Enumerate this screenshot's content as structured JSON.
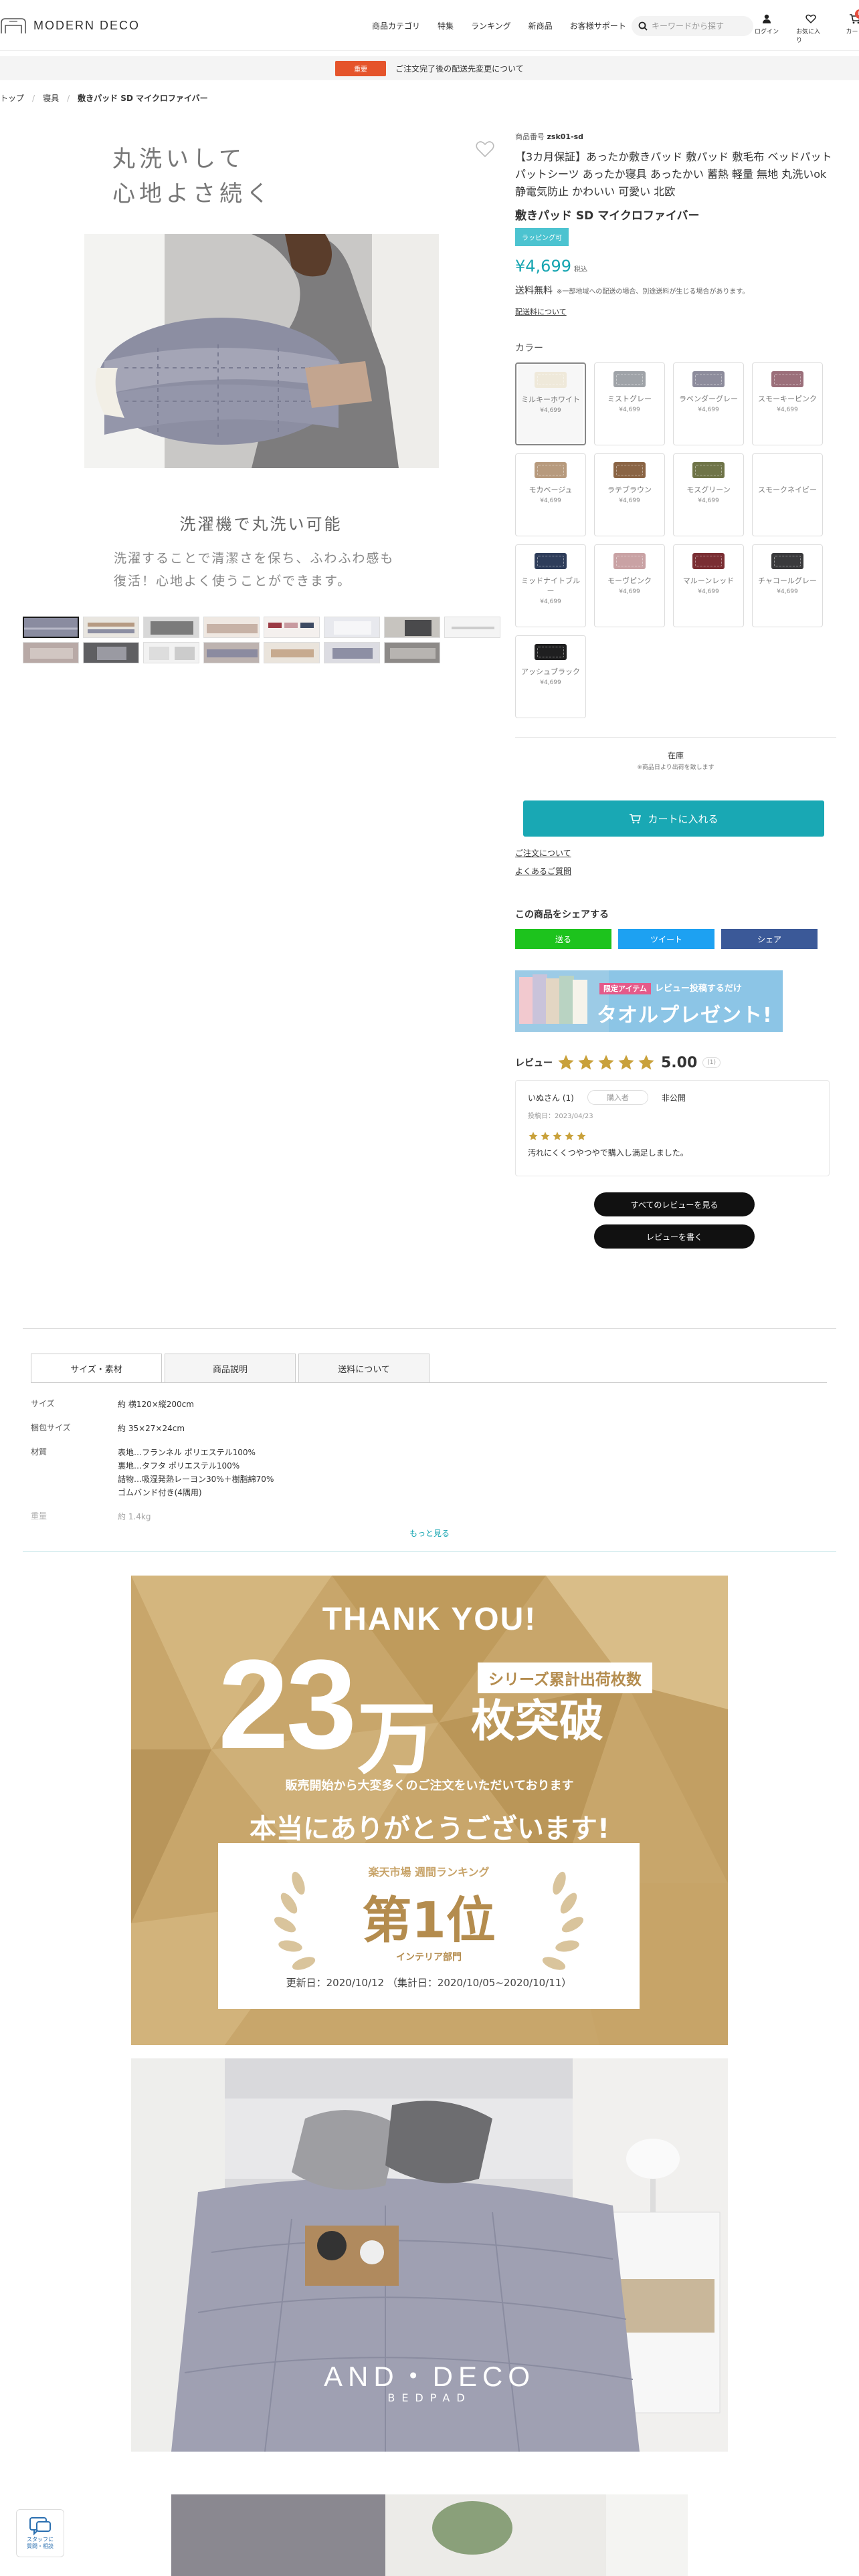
{
  "header": {
    "logo": "MODERN DECO",
    "nav": [
      "商品カテゴリ",
      "特集",
      "ランキング",
      "新商品",
      "お客様サポート"
    ],
    "search_placeholder": "キーワードから探す",
    "icons": [
      {
        "icon": "user-icon",
        "label": "ログイン"
      },
      {
        "icon": "heart-icon",
        "label": "お気に入り"
      },
      {
        "icon": "cart-icon",
        "label": "カート"
      }
    ],
    "cart_count": "0"
  },
  "notice": {
    "tag": "重要",
    "text": "ご注文完了後の配送先変更について"
  },
  "breadcrumb": [
    "トップ",
    "寝具",
    "敷きパッド SD マイクロファイバー"
  ],
  "gallery": {
    "headline_line1": "丸洗いして",
    "headline_line2": "心地よさ続く",
    "sub_title": "洗濯機で丸洗い可能",
    "sub_line1": "洗濯することで清潔さを保ち、ふわふわ感も",
    "sub_line2": "復活！心地よく使うことができます。"
  },
  "product": {
    "code_label": "商品番号",
    "code": "zsk01-sd",
    "title": "【3カ月保証】あったか敷きパッド 敷パッド 敷毛布 ベッドパット パットシーツ あったか寝具 あったかい 蓄熱 軽量 無地 丸洗いok 静電気防止 かわいい 可愛い 北欧",
    "name": "敷きパッド SD マイクロファイバー",
    "badge": "ラッピング可",
    "price": "¥4,699",
    "tax": "税込",
    "shipping": "送料無料",
    "shipping_note": "※一部地域への配送の場合、別途送料が生じる場合があります。",
    "shipping_link": "配送料について",
    "color_label": "カラー"
  },
  "swatches": [
    {
      "name": "ミルキーホワイト",
      "price": "¥4,699",
      "color": "#efe9da",
      "selected": true
    },
    {
      "name": "ミストグレー",
      "price": "¥4,699",
      "color": "#9fa3a8"
    },
    {
      "name": "ラベンダーグレー",
      "price": "¥4,699",
      "color": "#8d8c9c"
    },
    {
      "name": "スモーキーピンク",
      "price": "¥4,699",
      "color": "#9b6f7a"
    },
    {
      "name": "モカベージュ",
      "price": "¥4,699",
      "color": "#b79a7d"
    },
    {
      "name": "ラテブラウン",
      "price": "¥4,699",
      "color": "#8a6444"
    },
    {
      "name": "モスグリーン",
      "price": "¥4,699",
      "color": "#6f7448"
    },
    {
      "name": "スモークネイビー",
      "price": "",
      "color": "",
      "empty": true
    },
    {
      "name": "ミッドナイトブルー",
      "price": "¥4,699",
      "color": "#2e3d5a"
    },
    {
      "name": "モーヴピンク",
      "price": "¥4,699",
      "color": "#c9a2a4"
    },
    {
      "name": "マルーンレッド",
      "price": "¥4,699",
      "color": "#7a2e33"
    },
    {
      "name": "チャコールグレー",
      "price": "¥4,699",
      "color": "#3a3a3c"
    },
    {
      "name": "アッシュブラック",
      "price": "¥4,699",
      "color": "#1f1f20"
    }
  ],
  "stock": {
    "text": "在庫",
    "note": "※商品日より出荷を致します"
  },
  "cart_button": "カートに入れる",
  "links": [
    "ご注文について",
    "よくあるご質問"
  ],
  "share": {
    "title": "この商品をシェアする",
    "buttons": [
      {
        "label": "送る",
        "color": "#1dc31d"
      },
      {
        "label": "ツイート",
        "color": "#1da1f2"
      },
      {
        "label": "シェア",
        "color": "#3b5998"
      }
    ]
  },
  "review_banner": {
    "tag": "限定アイテム",
    "line1": "レビュー投稿するだけ",
    "line2": "タオルプレゼント!"
  },
  "reviews": {
    "label": "レビュー",
    "score": "5.00",
    "count": "(1)",
    "rating": 5,
    "item": {
      "user": "いぬさん (1)",
      "tag": "購入者",
      "status": "非公開",
      "date": "投稿日：2023/04/23",
      "body": "汚れにくくつやつやで購入し満足しました。"
    },
    "all_button": "すべてのレビューを見る",
    "write_button": "レビューを書く"
  },
  "tabs": [
    "サイズ・素材",
    "商品説明",
    "送料について"
  ],
  "spec": [
    {
      "k": "サイズ",
      "v": [
        "約 横120×縦200cm"
      ]
    },
    {
      "k": "梱包サイズ",
      "v": [
        "約 35×27×24cm"
      ]
    },
    {
      "k": "材質",
      "v": [
        "表地…フランネル ポリエステル100%",
        "裏地…タフタ ポリエステル100%",
        "詰物…吸湿発熱レーヨン30%＋樹脂綿70%",
        "ゴムバンド付き(4隅用)"
      ]
    },
    {
      "k": "重量",
      "v": [
        "約 1.4kg"
      ],
      "faded": true
    }
  ],
  "more_link": "もっと見る",
  "promo": {
    "thank_you": "THANK YOU!",
    "number": "23",
    "unit": "万",
    "series": "シリーズ累計出荷枚数",
    "break": "枚突破",
    "line1": "販売開始から大変多くのご注文をいただいております",
    "line2": "本当にありがとうございます!",
    "ranking": "楽天市場 週間ランキング",
    "first": "第1位",
    "dept": "インテリア部門",
    "updated": "更新日：2020/10/12 （集計日：2020/10/05~2020/10/11）"
  },
  "photo2": {
    "brand": "AND・DECO",
    "sub": "BEDPAD"
  },
  "chat": {
    "line1": "スタッフに",
    "line2": "質問・相談"
  }
}
